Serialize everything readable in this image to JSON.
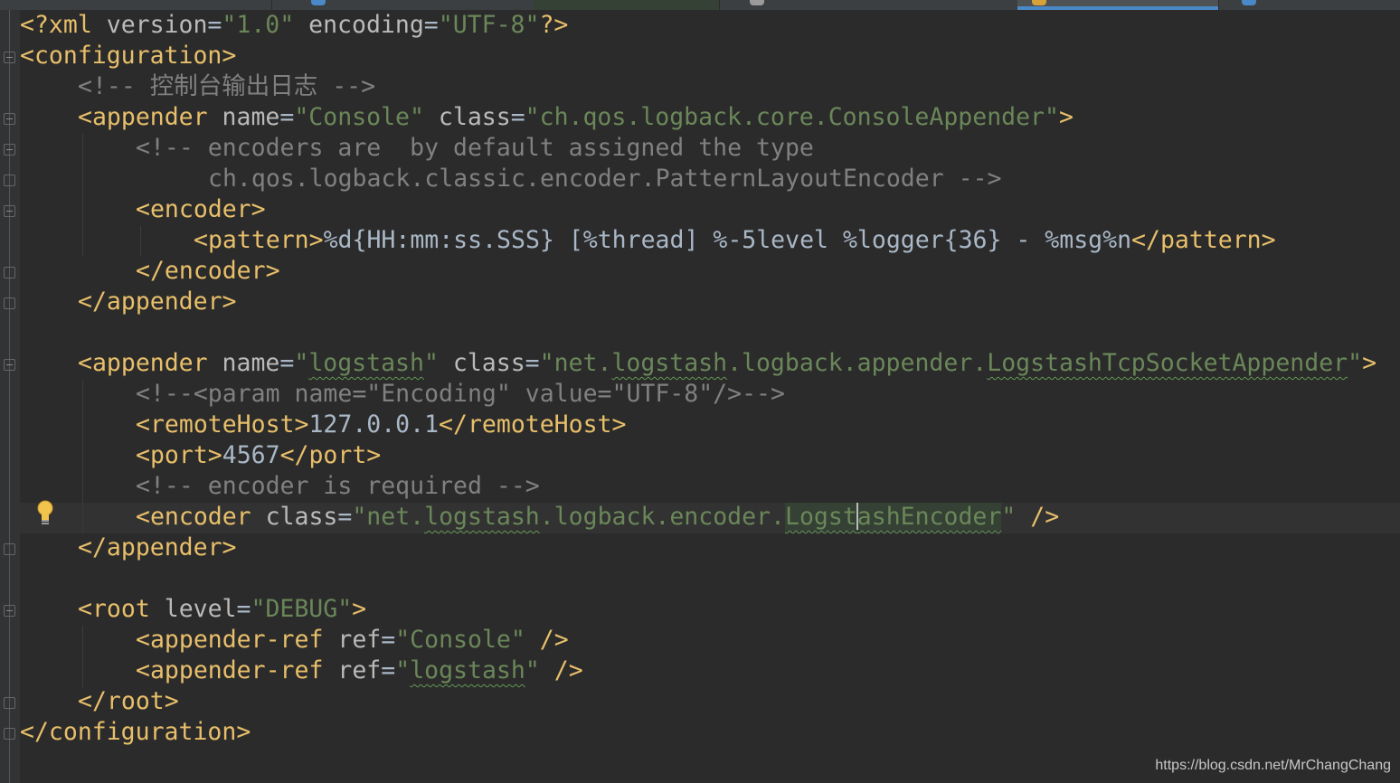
{
  "editor": {
    "lines": {
      "l1": {
        "p1": "<?xml ",
        "p2": "version",
        "p3": "=",
        "p4": "\"1.0\"",
        "p5": " ",
        "p6": "encoding",
        "p7": "=",
        "p8": "\"UTF-8\"",
        "p9": "?>"
      },
      "l2": {
        "p1": "<configuration>"
      },
      "l3": {
        "p1": "<!-- 控制台输出日志 -->"
      },
      "l4": {
        "p1": "<appender ",
        "p2": "name",
        "p3": "=",
        "p4": "\"Console\"",
        "p5": " ",
        "p6": "class",
        "p7": "=",
        "p8": "\"ch.qos.logback.core.ConsoleAppender\"",
        "p9": ">"
      },
      "l5": {
        "p1": "<!-- encoders are  by default assigned the type"
      },
      "l6": {
        "p1": "ch.qos.logback.classic.encoder.PatternLayoutEncoder -->"
      },
      "l7": {
        "p1": "<encoder>"
      },
      "l8": {
        "p1": "<pattern>",
        "p2": "%d{HH:mm:ss.SSS} [%thread] %-5level %logger{36} - %msg%n",
        "p3": "</pattern>"
      },
      "l9": {
        "p1": "</encoder>"
      },
      "l10": {
        "p1": "</appender>"
      },
      "l12": {
        "p1": "<appender ",
        "p2": "name",
        "p3": "=",
        "p4": "\"",
        "p5": "logstash",
        "p6": "\"",
        "p7": " ",
        "p8": "class",
        "p9": "=",
        "p10": "\"net.",
        "p11": "logstash",
        "p12": ".logback.appender.",
        "p13": "LogstashTcpSocketAppender",
        "p14": "\"",
        "p15": ">"
      },
      "l13": {
        "p1": "<!--<param name=\"Encoding\" value=\"UTF-8\"/>-->"
      },
      "l14": {
        "p1": "<remoteHost>",
        "p2": "127.0.0.1",
        "p3": "</remoteHost>"
      },
      "l15": {
        "p1": "<port>",
        "p2": "4567",
        "p3": "</port>"
      },
      "l16": {
        "p1": "<!-- encoder is required -->"
      },
      "l17": {
        "p1": "<encoder ",
        "p2": "class",
        "p3": "=",
        "p4": "\"net.",
        "p5": "logstash",
        "p6": ".logback.encoder.",
        "p7a": "Logst",
        "p7b": "ashEncoder",
        "p8": "\"",
        "p9": " />"
      },
      "l18": {
        "p1": "</appender>"
      },
      "l20": {
        "p1": "<root ",
        "p2": "level",
        "p3": "=",
        "p4": "\"DEBUG\"",
        "p5": ">"
      },
      "l21": {
        "p1": "<appender-ref ",
        "p2": "ref",
        "p3": "=",
        "p4": "\"Console\"",
        "p5": " />"
      },
      "l22": {
        "p1": "<appender-ref ",
        "p2": "ref",
        "p3": "=",
        "p4": "\"",
        "p5": "logstash",
        "p6": "\"",
        "p7": " />"
      },
      "l23": {
        "p1": "</root>"
      },
      "l24": {
        "p1": "</configuration>"
      }
    }
  },
  "watermark": "https://blog.csdn.net/MrChangChang",
  "colors": {
    "background": "#2b2b2b",
    "tag": "#e8bf6a",
    "attribute": "#bababa",
    "string": "#6a8759",
    "comment": "#808080",
    "text": "#a9b7c6"
  },
  "icons": [
    "fold-marker-icon",
    "lightbulb-icon",
    "text-caret"
  ]
}
